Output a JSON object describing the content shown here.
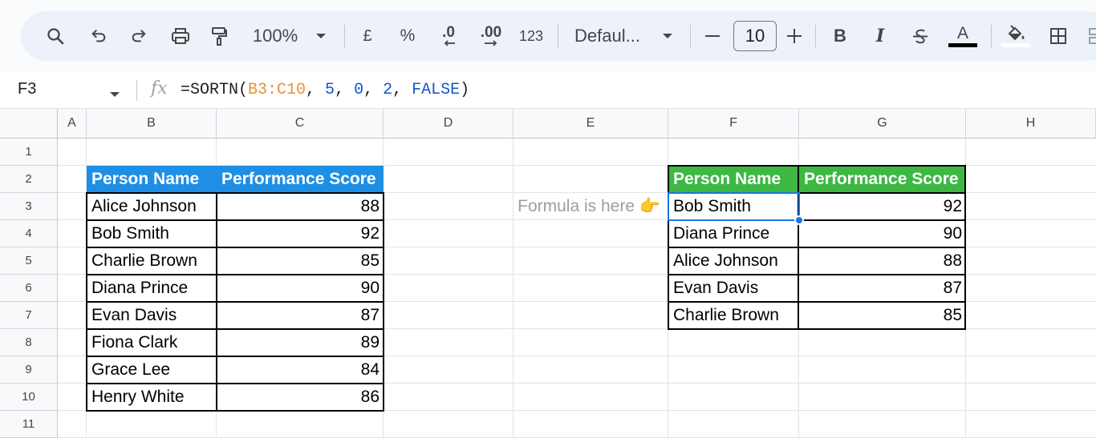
{
  "toolbar": {
    "zoom": "100%",
    "currency": "£",
    "percent": "%",
    "decrease_decimal": ".0",
    "increase_decimal": ".00",
    "number_format": "123",
    "font_name": "Defaul...",
    "font_size": "10",
    "bold": "B",
    "italic": "I",
    "text_color_letter": "A",
    "icons": [
      "search-icon",
      "undo-icon",
      "redo-icon",
      "print-icon",
      "paint-format-icon",
      "chevron-down-icon",
      "minus-icon",
      "plus-icon",
      "strikethrough-icon",
      "text-color-icon",
      "fill-color-icon",
      "borders-icon"
    ]
  },
  "formula_bar": {
    "cell_ref": "F3",
    "fx": "fx",
    "formula_prefix": "=SORTN(",
    "formula_range": "B3:C10",
    "formula_sep1": ", ",
    "arg_n": "5",
    "formula_sep2": ", ",
    "arg_tie": "0",
    "formula_sep3": ", ",
    "arg_col": "2",
    "formula_sep4": ", ",
    "arg_asc": "FALSE",
    "formula_suffix": ")"
  },
  "columns": [
    "A",
    "B",
    "C",
    "D",
    "E",
    "F",
    "G",
    "H"
  ],
  "rows": [
    "1",
    "2",
    "3",
    "4",
    "5",
    "6",
    "7",
    "8",
    "9",
    "10",
    "11"
  ],
  "source_table": {
    "headers": [
      "Person Name",
      "Performance Score"
    ],
    "rows": [
      [
        "Alice Johnson",
        "88"
      ],
      [
        "Bob Smith",
        "92"
      ],
      [
        "Charlie Brown",
        "85"
      ],
      [
        "Diana Prince",
        "90"
      ],
      [
        "Evan Davis",
        "87"
      ],
      [
        "Fiona Clark",
        "89"
      ],
      [
        "Grace Lee",
        "84"
      ],
      [
        "Henry White",
        "86"
      ]
    ],
    "header_color": "#1f8fe5"
  },
  "result_table": {
    "headers": [
      "Person Name",
      "Performance Score"
    ],
    "rows": [
      [
        "Bob Smith",
        "92"
      ],
      [
        "Diana Prince",
        "90"
      ],
      [
        "Alice Johnson",
        "88"
      ],
      [
        "Evan Davis",
        "87"
      ],
      [
        "Charlie Brown",
        "85"
      ]
    ],
    "header_color": "#3cb843"
  },
  "note": "Formula is here 👉",
  "selection": {
    "cell": "F3",
    "color": "#1a73e8"
  }
}
